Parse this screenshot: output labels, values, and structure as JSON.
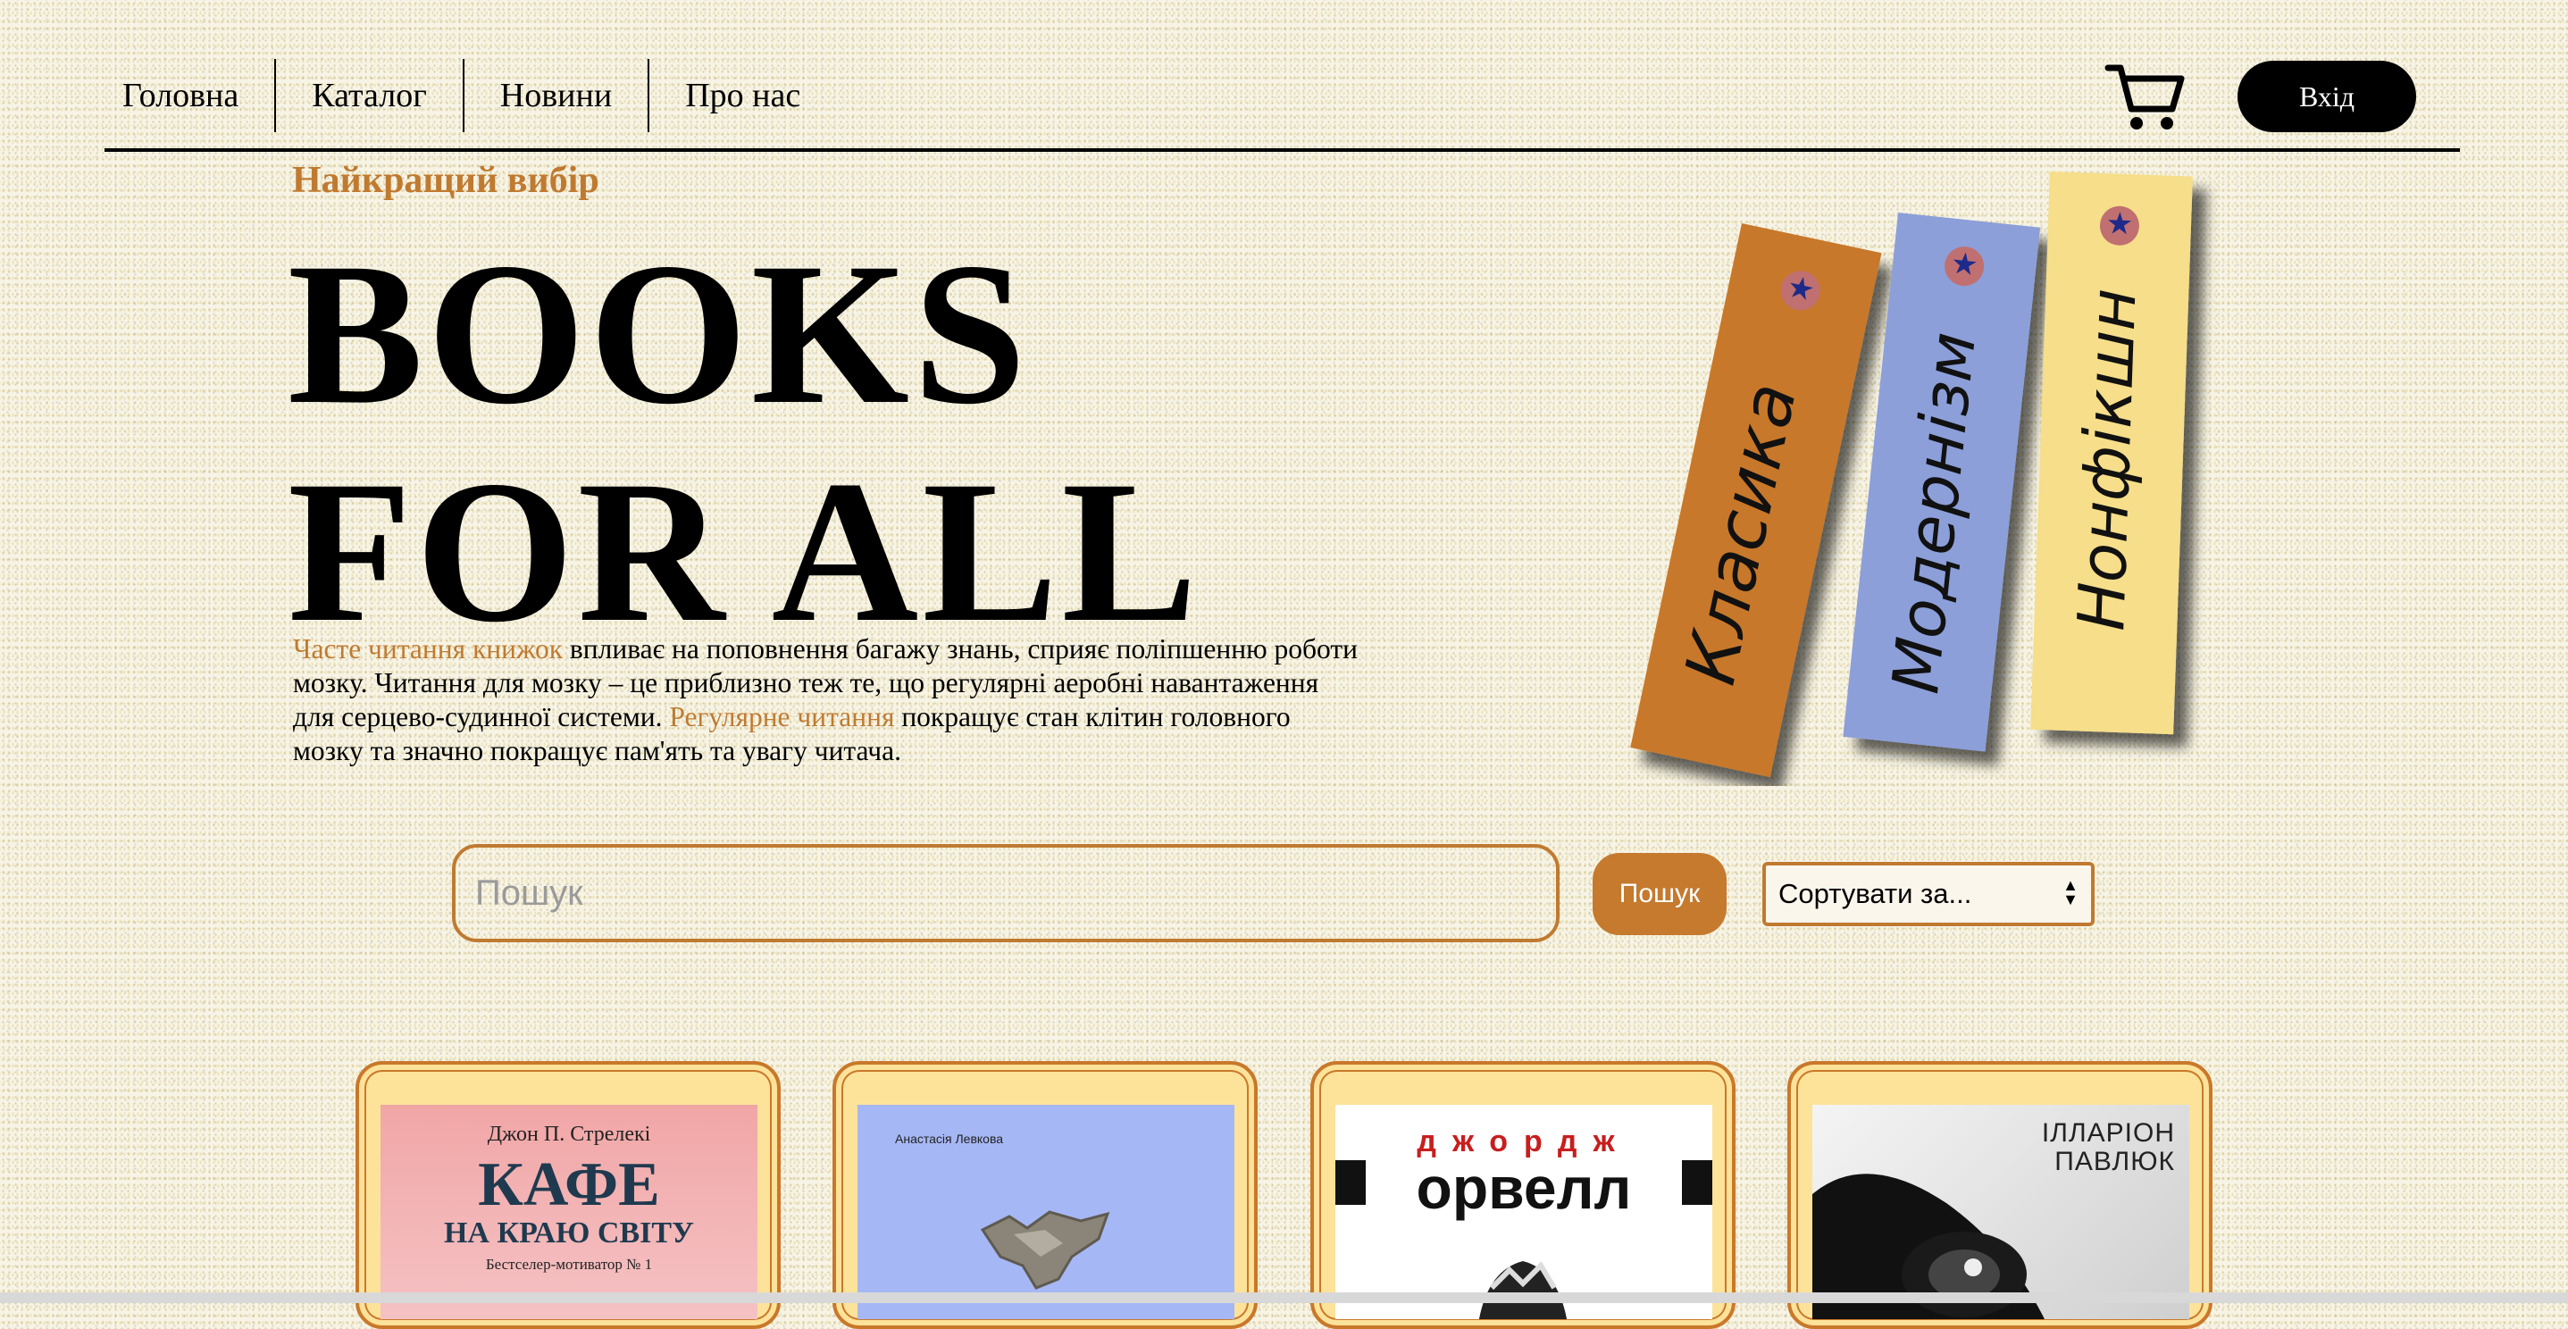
{
  "nav": {
    "items": [
      {
        "label": "Головна"
      },
      {
        "label": "Каталог"
      },
      {
        "label": "Новини"
      },
      {
        "label": "Про нас"
      }
    ],
    "cart_icon": "cart-icon",
    "login_label": "Вхід"
  },
  "hero": {
    "eyebrow": "Найкращий вибір",
    "title": "BOOKS FOR ALL",
    "intro": {
      "accent1": "Часте читання книжок",
      "text1": " впливає на поповнення багажу знань, сприяє поліпшенню роботи мозку. Читання для мозку – це приблизно теж те, що регулярні аеробні навантаження для серцево-судинної системи. ",
      "accent2": "Регулярне читання",
      "text2": " покращує стан клітин головного мозку та значно покращує пам'ять та увагу читача."
    },
    "bookmarks": [
      {
        "label": "Класика",
        "color": "#c8782a"
      },
      {
        "label": "Модернізм",
        "color": "#8c9fd9"
      },
      {
        "label": "Нонфікшн",
        "color": "#f6de8a"
      }
    ]
  },
  "search": {
    "placeholder": "Пошук",
    "button_label": "Пошук",
    "sort_label": "Сортувати за..."
  },
  "books": [
    {
      "author": "Джон П. Стрелекі",
      "title": "КАФЕ",
      "subtitle": "НА КРАЮ СВІТУ",
      "tagline": "Бестселер-мотиватор № 1"
    },
    {
      "author": "Анастасія Левкова"
    },
    {
      "author_first": "джордж",
      "author_last": "орвелл"
    },
    {
      "author_line1": "ІЛЛАРІОН",
      "author_line2": "ПАВЛЮК"
    }
  ],
  "colors": {
    "accent": "#c07a30",
    "card_bg": "#fde29a",
    "button": "#c57a2e"
  }
}
